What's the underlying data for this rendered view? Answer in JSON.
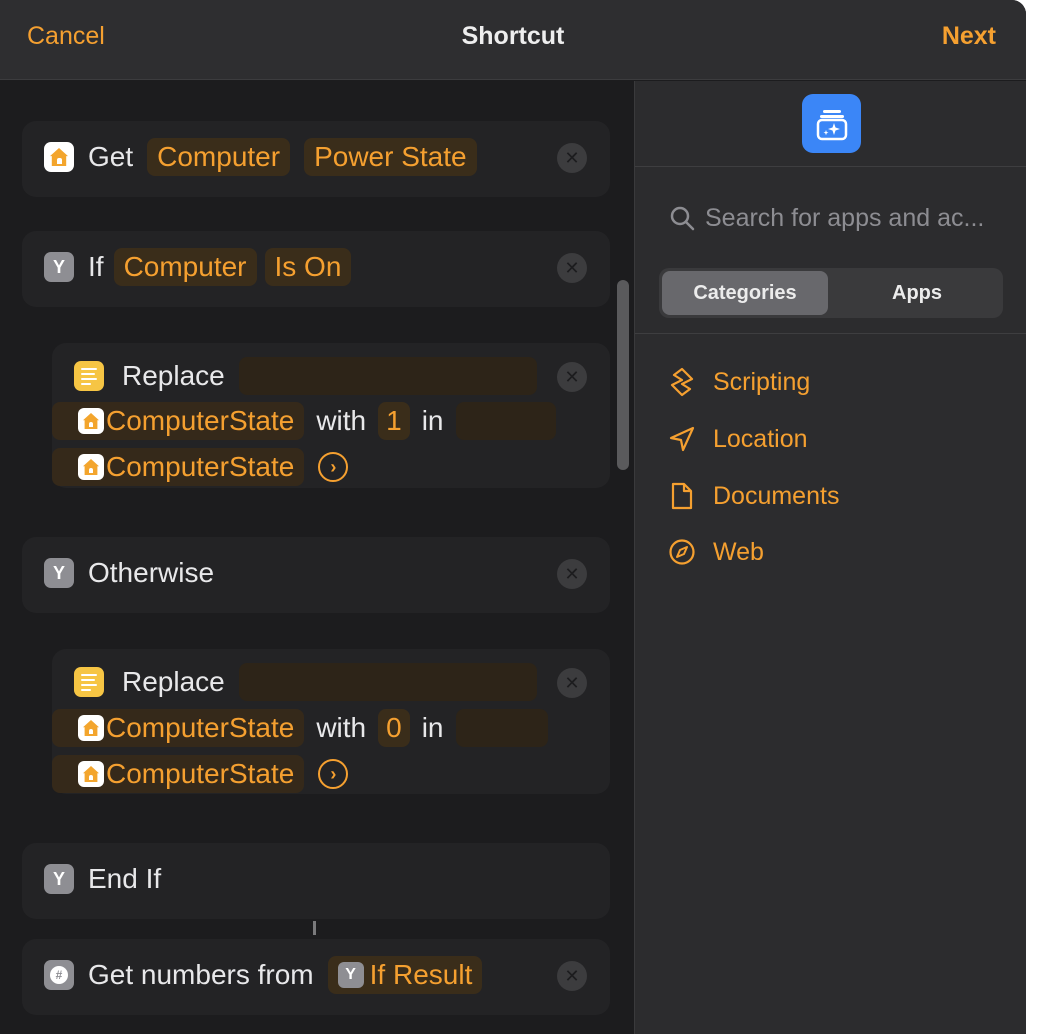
{
  "titlebar": {
    "cancel": "Cancel",
    "title": "Shortcut",
    "next": "Next"
  },
  "actions": {
    "get": {
      "label": "Get",
      "device": "Computer",
      "property": "Power State"
    },
    "if": {
      "label": "If",
      "subject": "Computer",
      "condition": "Is On"
    },
    "replace1": {
      "label": "Replace",
      "variable": "ComputerState",
      "with_label": "with",
      "value": "1",
      "in_label": "in",
      "target": "ComputerState"
    },
    "otherwise": {
      "label": "Otherwise"
    },
    "replace2": {
      "label": "Replace",
      "variable": "ComputerState",
      "with_label": "with",
      "value": "0",
      "in_label": "in",
      "target": "ComputerState"
    },
    "endif": {
      "label": "End If"
    },
    "get_numbers": {
      "label": "Get numbers from",
      "source": "If Result"
    }
  },
  "sidebar": {
    "search_placeholder": "Search for apps and ac...",
    "segments": {
      "categories": "Categories",
      "apps": "Apps"
    },
    "categories": [
      {
        "label": "Scripting",
        "icon": "scripting-icon"
      },
      {
        "label": "Location",
        "icon": "location-arrow-icon"
      },
      {
        "label": "Documents",
        "icon": "document-icon"
      },
      {
        "label": "Web",
        "icon": "compass-icon"
      }
    ]
  },
  "colors": {
    "accent": "#f5a030",
    "background": "#1c1c1e",
    "sidebar": "#2c2c2e",
    "app_icon_blue": "#3b86f7"
  }
}
